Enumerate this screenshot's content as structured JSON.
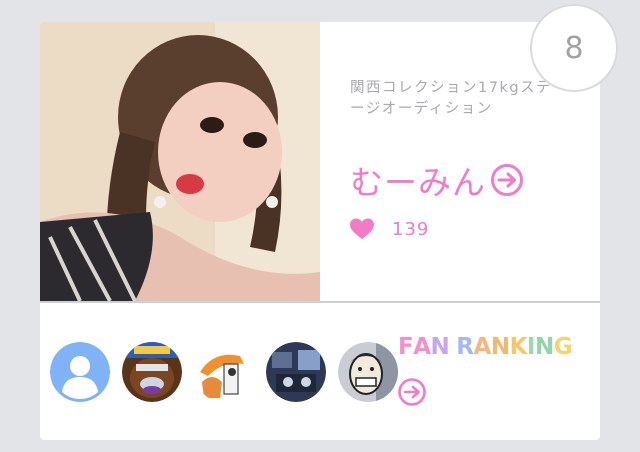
{
  "card": {
    "rank": "8",
    "description": "関西コレクション17kgステージオーディション",
    "name": "むーみん",
    "likes": "139"
  },
  "fan_ranking": {
    "letters": [
      {
        "ch": "F",
        "color": "#f48fcf"
      },
      {
        "ch": "A",
        "color": "#f48fcf"
      },
      {
        "ch": "N",
        "color": "#c7a4ee"
      },
      {
        "ch": " ",
        "color": "#ffffff"
      },
      {
        "ch": "R",
        "color": "#a6b8f3"
      },
      {
        "ch": "A",
        "color": "#f6b77c"
      },
      {
        "ch": "N",
        "color": "#f3b86e"
      },
      {
        "ch": "K",
        "color": "#f6c66b"
      },
      {
        "ch": "I",
        "color": "#9ed7b0"
      },
      {
        "ch": "N",
        "color": "#8fd6a9"
      },
      {
        "ch": "G",
        "color": "#f6d36f"
      }
    ]
  },
  "colors": {
    "accent": "#f27ac7",
    "background": "#e3e4e7",
    "text_muted": "#a8a8ad"
  },
  "icons": {
    "like": "heart-icon",
    "profile_link": "circle-arrow-right-icon",
    "ranking_link": "circle-arrow-right-icon"
  }
}
